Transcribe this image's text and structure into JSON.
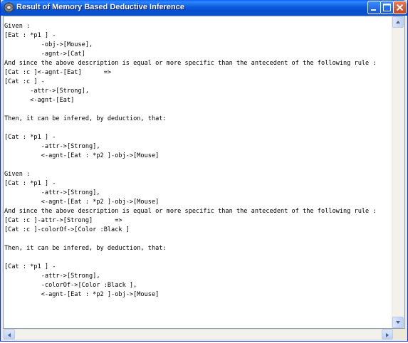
{
  "window": {
    "title": "Result of Memory Based Deductive Inference",
    "icon": "app-gear-icon",
    "buttons": {
      "minimize": "minimize-icon",
      "maximize": "maximize-icon",
      "close": "close-icon"
    }
  },
  "content": {
    "lines": [
      "Given :",
      "[Eat : *p1 ] -",
      "          -obj->[Mouse],",
      "          -agnt->[Cat]",
      "And since the above description is equal or more specific than the antecedent of the following rule :",
      "[Cat :c ]<-agnt-[Eat]      =>",
      "[Cat :c ] -",
      "       -attr->[Strong],",
      "       <-agnt-[Eat]",
      "",
      "Then, it can be infered, by deduction, that:",
      "",
      "[Cat : *p1 ] -",
      "          -attr->[Strong],",
      "          <-agnt-[Eat : *p2 ]-obj->[Mouse]",
      "",
      "Given :",
      "[Cat : *p1 ] -",
      "          -attr->[Strong],",
      "          <-agnt-[Eat : *p2 ]-obj->[Mouse]",
      "And since the above description is equal or more specific than the antecedent of the following rule :",
      "[Cat :c ]-attr->[Strong]      =>",
      "[Cat :c ]-colorOf->[Color :Black ]",
      "",
      "Then, it can be infered, by deduction, that:",
      "",
      "[Cat : *p1 ] -",
      "          -attr->[Strong],",
      "          -colorOf->[Color :Black ],",
      "          <-agnt-[Eat : *p2 ]-obj->[Mouse]"
    ]
  },
  "colors": {
    "titlebar": "#0b5bdb",
    "close_button": "#c6421b",
    "window_frame": "#0831d9"
  }
}
